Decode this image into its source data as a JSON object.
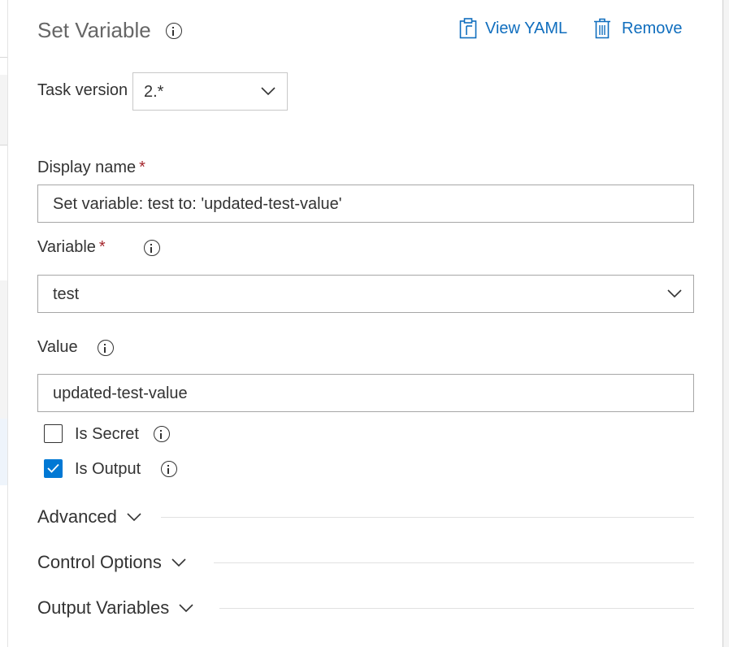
{
  "panel": {
    "title": "Set Variable",
    "view_yaml_label": "View YAML",
    "remove_label": "Remove"
  },
  "task_version": {
    "label": "Task version",
    "value": "2.*"
  },
  "display_name": {
    "label": "Display name",
    "required_mark": "*",
    "value": "Set variable: test to: 'updated-test-value'"
  },
  "variable": {
    "label": "Variable",
    "required_mark": "*",
    "value": "test"
  },
  "value_field": {
    "label": "Value",
    "value": "updated-test-value"
  },
  "is_secret": {
    "label": "Is Secret",
    "checked": false
  },
  "is_output": {
    "label": "Is Output",
    "checked": true
  },
  "sections": {
    "advanced": "Advanced",
    "control_options": "Control Options",
    "output_variables": "Output Variables"
  },
  "colors": {
    "accent": "#0078d4",
    "link": "#106ebe",
    "required": "#a4262c"
  }
}
